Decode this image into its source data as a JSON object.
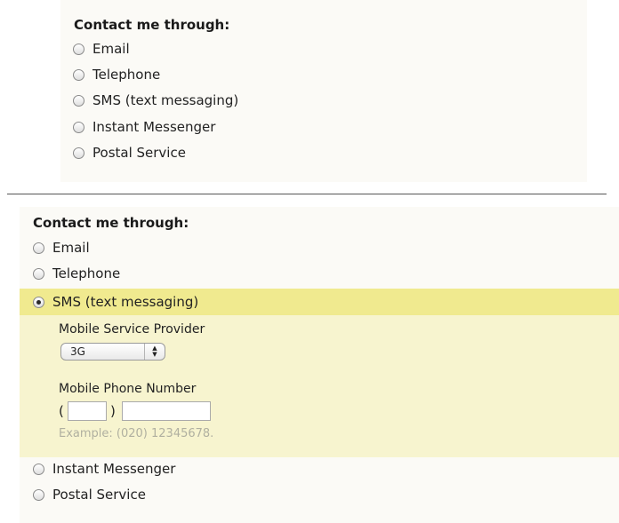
{
  "before": {
    "title": "Contact me through:",
    "options": [
      {
        "label": "Email",
        "checked": false
      },
      {
        "label": "Telephone",
        "checked": false
      },
      {
        "label": "SMS (text messaging)",
        "checked": false
      },
      {
        "label": "Instant Messenger",
        "checked": false
      },
      {
        "label": "Postal Service",
        "checked": false
      }
    ]
  },
  "after": {
    "title": "Contact me through:",
    "options": [
      {
        "label": "Email",
        "checked": false
      },
      {
        "label": "Telephone",
        "checked": false
      },
      {
        "label": "SMS (text messaging)",
        "checked": true
      },
      {
        "label": "Instant Messenger",
        "checked": false
      },
      {
        "label": "Postal Service",
        "checked": false
      }
    ],
    "sms_details": {
      "provider_label": "Mobile Service Provider",
      "provider_value": "3G",
      "phone_label": "Mobile Phone Number",
      "area_code_value": "",
      "number_value": "",
      "open_paren": "(",
      "close_paren": ")",
      "example": "Example: (020) 12345678."
    }
  },
  "colors": {
    "panel_bg": "#fbfaf6",
    "selected_row_bg": "#f0ea8f",
    "details_bg": "#f7f4cf",
    "hint_text": "#b0b0a0"
  }
}
